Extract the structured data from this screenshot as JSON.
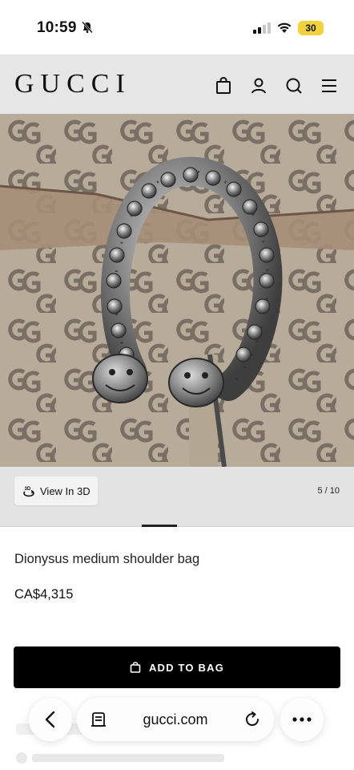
{
  "status_bar": {
    "time": "10:59",
    "battery": "30",
    "icons": [
      "bell-off-icon",
      "signal-icon",
      "wifi-icon",
      "battery-icon"
    ]
  },
  "header": {
    "logo": "GUCCI",
    "icons": [
      "shopping-bag-icon",
      "account-icon",
      "search-icon",
      "menu-icon"
    ]
  },
  "gallery": {
    "view_3d_label": "View In 3D",
    "pager": "5 / 10"
  },
  "product": {
    "name": "Dionysus medium shoulder bag",
    "price": "CA$4,315",
    "add_to_bag_label": "ADD TO BAG"
  },
  "browser": {
    "url": "gucci.com",
    "icons": [
      "back-icon",
      "reader-icon",
      "reload-icon",
      "more-icon"
    ]
  },
  "colors": {
    "header_bg": "#e6e6e6",
    "button_bg": "#000000",
    "battery_bg": "#f2d23a"
  }
}
